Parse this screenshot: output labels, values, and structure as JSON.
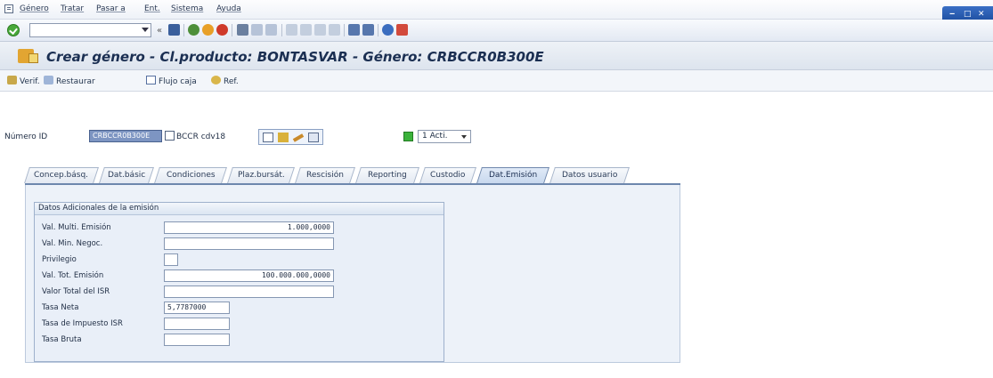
{
  "menubar": {
    "items": [
      "Género",
      "Tratar",
      "Pasar a",
      "Ent.",
      "Sistema",
      "Ayuda"
    ]
  },
  "toolbar": {
    "command_placeholder": ""
  },
  "title": "Crear género - Cl.producto: BONTASVAR - Género: CRBCCR0B300E",
  "app_toolbar": {
    "verif": "Verif.",
    "restaurar": "Restaurar",
    "flujo_caja": "Flujo caja",
    "ref": "Ref."
  },
  "header": {
    "numero_label": "Número ID",
    "numero_value": "CRBCCR0B300E",
    "bccr_label": "BCCR cdv18",
    "act_value": "1 Acti."
  },
  "tabs": [
    {
      "label": "Concep.básq."
    },
    {
      "label": "Dat.básic"
    },
    {
      "label": "Condiciones"
    },
    {
      "label": "Plaz.bursát."
    },
    {
      "label": "Rescisión"
    },
    {
      "label": "Reporting"
    },
    {
      "label": "Custodio"
    },
    {
      "label": "Dat.Emisión"
    },
    {
      "label": "Datos usuario"
    }
  ],
  "group": {
    "title": "Datos Adicionales de la emisión",
    "fields": [
      {
        "label": "Val. Multi. Emisión",
        "value": "1.000,0000"
      },
      {
        "label": "Val. Min. Negoc.",
        "value": ""
      },
      {
        "label": "Privilegio",
        "value": ""
      },
      {
        "label": "Val. Tot. Emisión",
        "value": "100.000.000,0000"
      },
      {
        "label": "Valor Total del ISR",
        "value": ""
      },
      {
        "label": "Tasa Neta",
        "value": "5,7787000"
      },
      {
        "label": "Tasa de Impuesto ISR",
        "value": ""
      },
      {
        "label": "Tasa Bruta",
        "value": ""
      }
    ]
  }
}
